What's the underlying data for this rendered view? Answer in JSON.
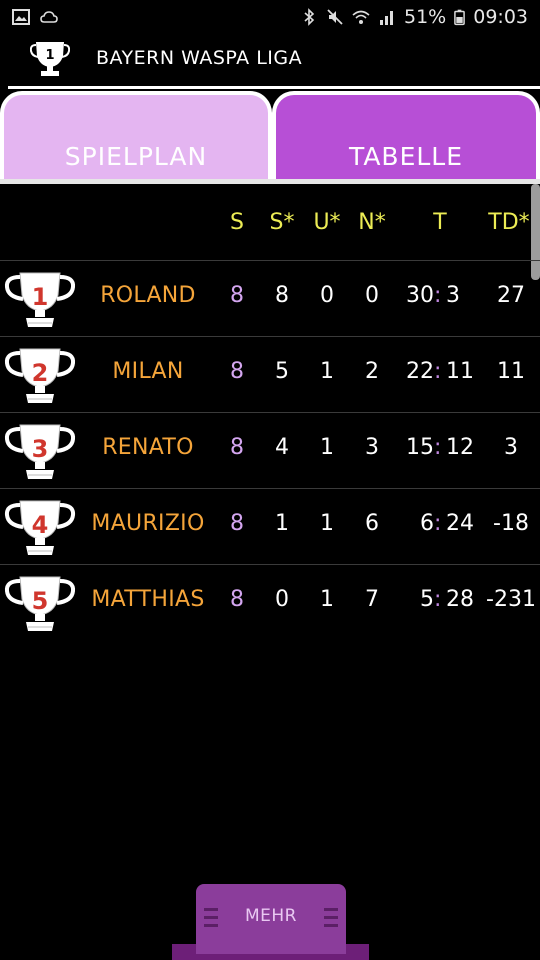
{
  "status": {
    "battery": "51%",
    "time": "09:03"
  },
  "app": {
    "title": "BAYERN WASPA LIGA",
    "logo_number": "1"
  },
  "tabs": [
    {
      "label": "SPIELPLAN",
      "active": false
    },
    {
      "label": "TABELLE",
      "active": true
    }
  ],
  "table": {
    "headers": [
      "S",
      "S*",
      "U*",
      "N*",
      "T",
      "TD*"
    ],
    "rows": [
      {
        "rank": "1",
        "name": "ROLAND",
        "s": "8",
        "w": "8",
        "d": "0",
        "l": "0",
        "gf": "30",
        "ga": "3",
        "td": "27"
      },
      {
        "rank": "2",
        "name": "MILAN",
        "s": "8",
        "w": "5",
        "d": "1",
        "l": "2",
        "gf": "22",
        "ga": "11",
        "td": "11"
      },
      {
        "rank": "3",
        "name": "RENATO",
        "s": "8",
        "w": "4",
        "d": "1",
        "l": "3",
        "gf": "15",
        "ga": "12",
        "td": "3"
      },
      {
        "rank": "4",
        "name": "MAURIZIO",
        "s": "8",
        "w": "1",
        "d": "1",
        "l": "6",
        "gf": "6",
        "ga": "24",
        "td": "-18"
      },
      {
        "rank": "5",
        "name": "MATTHIAS",
        "s": "8",
        "w": "0",
        "d": "1",
        "l": "7",
        "gf": "5",
        "ga": "28",
        "td": "-231"
      }
    ],
    "goal_separator": ":"
  },
  "bottom": {
    "more_label": "MEHR"
  },
  "colors": {
    "tab_inactive": "#e4b5f1",
    "tab_active": "#b74fd6",
    "header_text": "#ecec55",
    "name_text": "#f5a53a",
    "rank_text": "#d0362d",
    "games_text": "#d4a6f0"
  },
  "icons": [
    "image-icon",
    "cloud-icon",
    "bluetooth-icon",
    "mute-icon",
    "wifi-icon",
    "signal-icon",
    "battery-icon",
    "trophy-icon",
    "grip-icon"
  ]
}
